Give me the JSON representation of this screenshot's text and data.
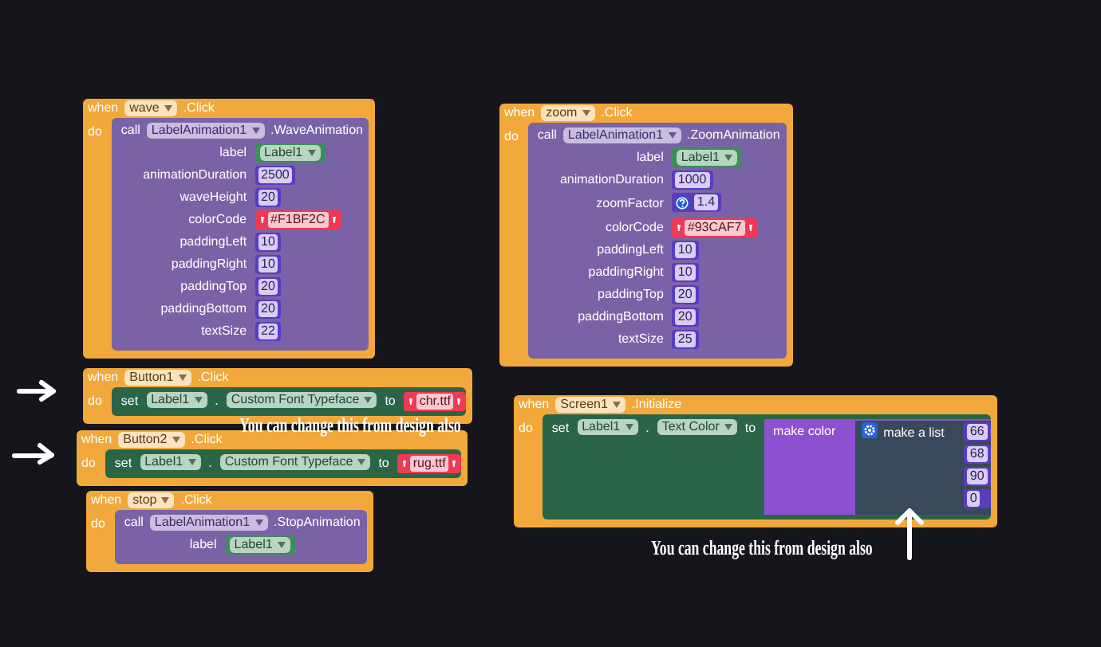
{
  "canvas": {
    "events": [
      {
        "when": "when",
        "component": "wave",
        "event": ".Click",
        "do": "do",
        "statement": {
          "kind": "call",
          "keyword": "call",
          "component": "LabelAnimation1",
          "method": ".WaveAnimation",
          "args": [
            {
              "name": "label",
              "value": {
                "kind": "component",
                "value": "Label1"
              }
            },
            {
              "name": "animationDuration",
              "value": {
                "kind": "number",
                "value": "2500"
              }
            },
            {
              "name": "waveHeight",
              "value": {
                "kind": "number",
                "value": "20"
              }
            },
            {
              "name": "colorCode",
              "value": {
                "kind": "text",
                "value": "#F1BF2C"
              }
            },
            {
              "name": "paddingLeft",
              "value": {
                "kind": "number",
                "value": "10"
              }
            },
            {
              "name": "paddingRight",
              "value": {
                "kind": "number",
                "value": "10"
              }
            },
            {
              "name": "paddingTop",
              "value": {
                "kind": "number",
                "value": "20"
              }
            },
            {
              "name": "paddingBottom",
              "value": {
                "kind": "number",
                "value": "20"
              }
            },
            {
              "name": "textSize",
              "value": {
                "kind": "number",
                "value": "22"
              }
            }
          ]
        }
      },
      {
        "when": "when",
        "component": "zoom",
        "event": ".Click",
        "do": "do",
        "statement": {
          "kind": "call",
          "keyword": "call",
          "component": "LabelAnimation1",
          "method": ".ZoomAnimation",
          "args": [
            {
              "name": "label",
              "value": {
                "kind": "component",
                "value": "Label1"
              }
            },
            {
              "name": "animationDuration",
              "value": {
                "kind": "number",
                "value": "1000"
              }
            },
            {
              "name": "zoomFactor",
              "value": {
                "kind": "help_number",
                "value": "1.4"
              }
            },
            {
              "name": "colorCode",
              "value": {
                "kind": "text",
                "value": "#93CAF7"
              }
            },
            {
              "name": "paddingLeft",
              "value": {
                "kind": "number",
                "value": "10"
              }
            },
            {
              "name": "paddingRight",
              "value": {
                "kind": "number",
                "value": "10"
              }
            },
            {
              "name": "paddingTop",
              "value": {
                "kind": "number",
                "value": "20"
              }
            },
            {
              "name": "paddingBottom",
              "value": {
                "kind": "number",
                "value": "20"
              }
            },
            {
              "name": "textSize",
              "value": {
                "kind": "number",
                "value": "25"
              }
            }
          ]
        }
      },
      {
        "when": "when",
        "component": "Button1",
        "event": ".Click",
        "do": "do",
        "statement": {
          "kind": "set",
          "keyword": "set",
          "component": "Label1",
          "dot": ".",
          "property": "Custom Font Typeface",
          "to": "to",
          "value": {
            "kind": "text",
            "value": "chr.ttf"
          }
        }
      },
      {
        "when": "when",
        "component": "Button2",
        "event": ".Click",
        "do": "do",
        "statement": {
          "kind": "set",
          "keyword": "set",
          "component": "Label1",
          "dot": ".",
          "property": "Custom Font Typeface",
          "to": "to",
          "value": {
            "kind": "text",
            "value": "rug.ttf"
          }
        }
      },
      {
        "when": "when",
        "component": "stop",
        "event": ".Click",
        "do": "do",
        "statement": {
          "kind": "call",
          "keyword": "call",
          "component": "LabelAnimation1",
          "method": ".StopAnimation",
          "args": [
            {
              "name": "label",
              "value": {
                "kind": "component",
                "value": "Label1"
              }
            }
          ]
        }
      },
      {
        "when": "when",
        "component": "Screen1",
        "event": ".Initialize",
        "do": "do",
        "statement": {
          "kind": "set",
          "keyword": "set",
          "component": "Label1",
          "dot": ".",
          "property": "Text Color",
          "to": "to",
          "value": {
            "kind": "make_color",
            "label": "make color",
            "list": {
              "label": "make a list",
              "items": [
                {
                  "kind": "number",
                  "value": "66"
                },
                {
                  "kind": "number",
                  "value": "68"
                },
                {
                  "kind": "number",
                  "value": "90"
                },
                {
                  "kind": "number",
                  "value": "0"
                }
              ]
            }
          }
        }
      }
    ],
    "notes": [
      {
        "text": "You can change this from design also"
      },
      {
        "text": "You can change this from design also"
      }
    ]
  }
}
